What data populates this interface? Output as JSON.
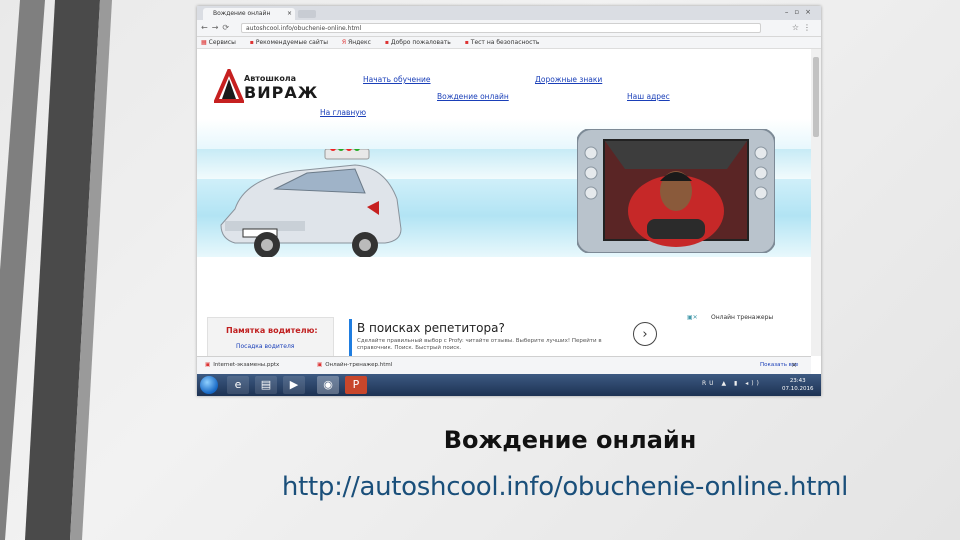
{
  "browser": {
    "tab_title": "Вождение онлайн",
    "url": "autoshcool.info/obuchenie-online.html",
    "bookmarks": [
      "Сервисы",
      "Рекомендуемые сайты",
      "Яндекс",
      "Добро пожаловать",
      "Тест на безопасность"
    ]
  },
  "site": {
    "logo_small": "Автошкола",
    "logo_big": "ВИРАЖ",
    "nav": {
      "start": "Начать обучение",
      "signs": "Дорожные знаки",
      "driving": "Вождение онлайн",
      "address": "Наш адрес",
      "home": "На главную"
    },
    "memo_title": "Памятка водителю:",
    "memo_item": "Посадка водителя",
    "ad_title": "В поисках репетитора?",
    "ad_text": "Сделайте правильный выбор с Profy: читайте отзывы. Выберите лучших! Перейти в справочник. Поиск. Быстрый поиск.",
    "online_label": "Онлайн тренажеры"
  },
  "downloads": {
    "item1": "Internet-экзамены.pptx",
    "item2": "Онлайн-тренажер.html",
    "show_all": "Показать все"
  },
  "taskbar": {
    "tray_lang": "RU",
    "time": "23:43",
    "date": "07.10.2016"
  },
  "slide": {
    "caption": "Вождение онлайн",
    "url": "http://autoshcool.info/obuchenie-online.html"
  }
}
